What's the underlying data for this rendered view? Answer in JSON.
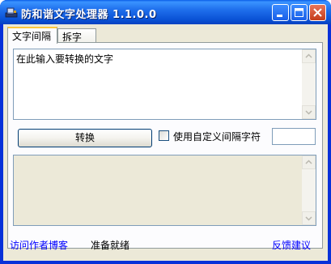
{
  "window": {
    "title": "防和谐文字处理器 1.1.0.0",
    "controls": {
      "minimize": "minimize",
      "maximize": "maximize",
      "close": "close"
    }
  },
  "tabs": [
    {
      "label": "文字间隔",
      "active": true
    },
    {
      "label": "拆字",
      "active": false
    }
  ],
  "input_text": {
    "value": "在此输入要转换的文字"
  },
  "convert_button": {
    "label": "转换"
  },
  "custom_separator": {
    "label": "使用自定义间隔字符",
    "checked": false,
    "value": ""
  },
  "output_text": {
    "value": ""
  },
  "footer": {
    "visit_blog_link": "访问作者博客",
    "status": "准备就绪",
    "feedback_link": "反馈建议"
  },
  "icons": {
    "app": "app-icon",
    "scroll_up": "arrow-up-icon",
    "scroll_down": "arrow-down-icon"
  }
}
